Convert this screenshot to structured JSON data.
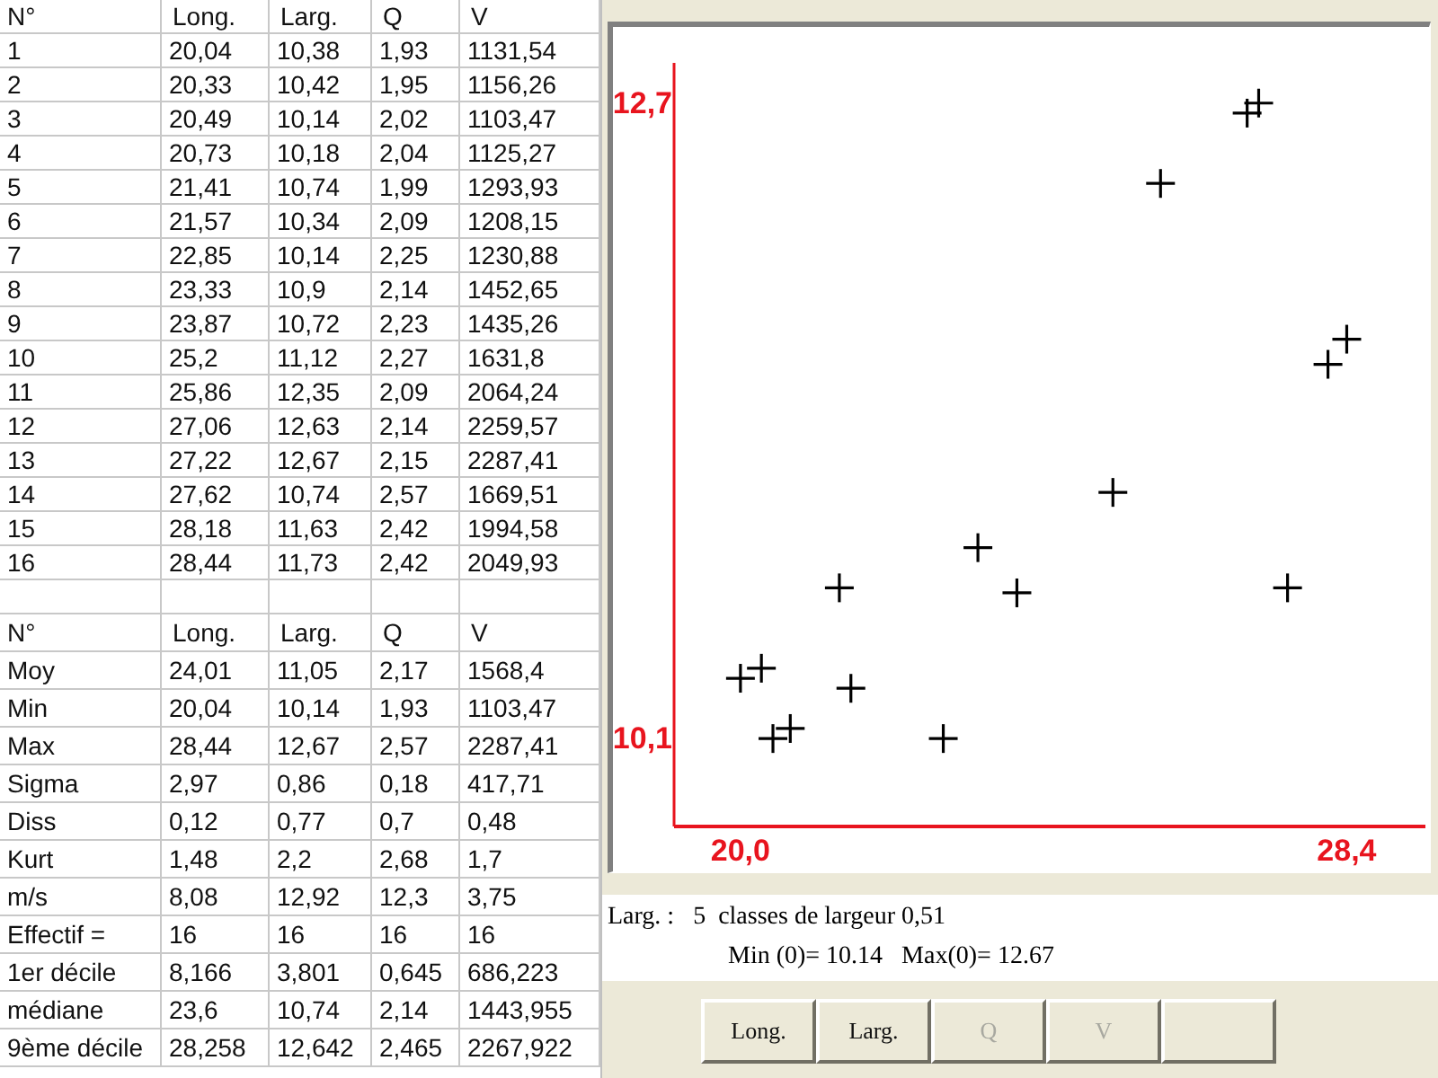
{
  "table": {
    "columns": [
      "N°",
      "Long.",
      "Larg.",
      "Q",
      "V"
    ],
    "rows": [
      [
        "1",
        "20,04",
        "10,38",
        "1,93",
        "1131,54"
      ],
      [
        "2",
        "20,33",
        "10,42",
        "1,95",
        "1156,26"
      ],
      [
        "3",
        "20,49",
        "10,14",
        "2,02",
        "1103,47"
      ],
      [
        "4",
        "20,73",
        "10,18",
        "2,04",
        "1125,27"
      ],
      [
        "5",
        "21,41",
        "10,74",
        "1,99",
        "1293,93"
      ],
      [
        "6",
        "21,57",
        "10,34",
        "2,09",
        "1208,15"
      ],
      [
        "7",
        "22,85",
        "10,14",
        "2,25",
        "1230,88"
      ],
      [
        "8",
        "23,33",
        "10,9",
        "2,14",
        "1452,65"
      ],
      [
        "9",
        "23,87",
        "10,72",
        "2,23",
        "1435,26"
      ],
      [
        "10",
        "25,2",
        "11,12",
        "2,27",
        "1631,8"
      ],
      [
        "11",
        "25,86",
        "12,35",
        "2,09",
        "2064,24"
      ],
      [
        "12",
        "27,06",
        "12,63",
        "2,14",
        "2259,57"
      ],
      [
        "13",
        "27,22",
        "12,67",
        "2,15",
        "2287,41"
      ],
      [
        "14",
        "27,62",
        "10,74",
        "2,57",
        "1669,51"
      ],
      [
        "15",
        "28,18",
        "11,63",
        "2,42",
        "1994,58"
      ],
      [
        "16",
        "28,44",
        "11,73",
        "2,42",
        "2049,93"
      ]
    ]
  },
  "stats": {
    "columns": [
      "N°",
      "Long.",
      "Larg.",
      "Q",
      "V"
    ],
    "rows": [
      [
        "Moy",
        "24,01",
        "11,05",
        "2,17",
        "1568,4"
      ],
      [
        "Min",
        "20,04",
        "10,14",
        "1,93",
        "1103,47"
      ],
      [
        "Max",
        "28,44",
        "12,67",
        "2,57",
        "2287,41"
      ],
      [
        "Sigma",
        "2,97",
        "0,86",
        "0,18",
        "417,71"
      ],
      [
        "Diss",
        "0,12",
        "0,77",
        "0,7",
        "0,48"
      ],
      [
        "Kurt",
        "1,48",
        "2,2",
        "2,68",
        "1,7"
      ],
      [
        "m/s",
        "8,08",
        "12,92",
        "12,3",
        "3,75"
      ],
      [
        "Effectif =",
        "16",
        "16",
        "16",
        "16"
      ],
      [
        "1er décile",
        "8,166",
        "3,801",
        "0,645",
        "686,223"
      ],
      [
        "médiane",
        "23,6",
        "10,74",
        "2,14",
        "1443,955"
      ],
      [
        "9ème décile",
        "28,258",
        "12,642",
        "2,465",
        "2267,922"
      ]
    ]
  },
  "chart": {
    "chart_data": {
      "type": "scatter",
      "x": [
        20.04,
        20.33,
        20.49,
        20.73,
        21.41,
        21.57,
        22.85,
        23.33,
        23.87,
        25.2,
        25.86,
        27.06,
        27.22,
        27.62,
        28.18,
        28.44
      ],
      "series": [
        {
          "color": "#000000",
          "values": [
            10.38,
            10.42,
            10.14,
            10.18,
            10.74,
            10.34,
            10.14,
            10.9,
            10.72,
            11.12,
            12.35,
            12.63,
            12.67,
            10.74,
            11.63,
            11.73
          ]
        }
      ],
      "xlim": [
        19.12,
        29.53
      ],
      "ylim": [
        9.79,
        12.83
      ],
      "xticks": [
        {
          "value": 20.04,
          "label": "20,0"
        },
        {
          "value": 28.44,
          "label": "28,4"
        }
      ],
      "yticks": [
        {
          "value": 10.14,
          "label": "10,1"
        },
        {
          "value": 12.67,
          "label": "12,7"
        }
      ]
    }
  },
  "info": {
    "line_1": "Larg. :   5  classes de largeur 0,51",
    "line_2": "Min (0)= 10.14   Max(0)= 12.67"
  },
  "buttons": [
    {
      "kind": "text",
      "label": "Long.",
      "disabled": false
    },
    {
      "kind": "text",
      "label": "Larg.",
      "disabled": false
    },
    {
      "kind": "text",
      "label": "Q",
      "disabled": true
    },
    {
      "kind": "text",
      "label": "V",
      "disabled": true
    },
    {
      "kind": "blank"
    }
  ]
}
